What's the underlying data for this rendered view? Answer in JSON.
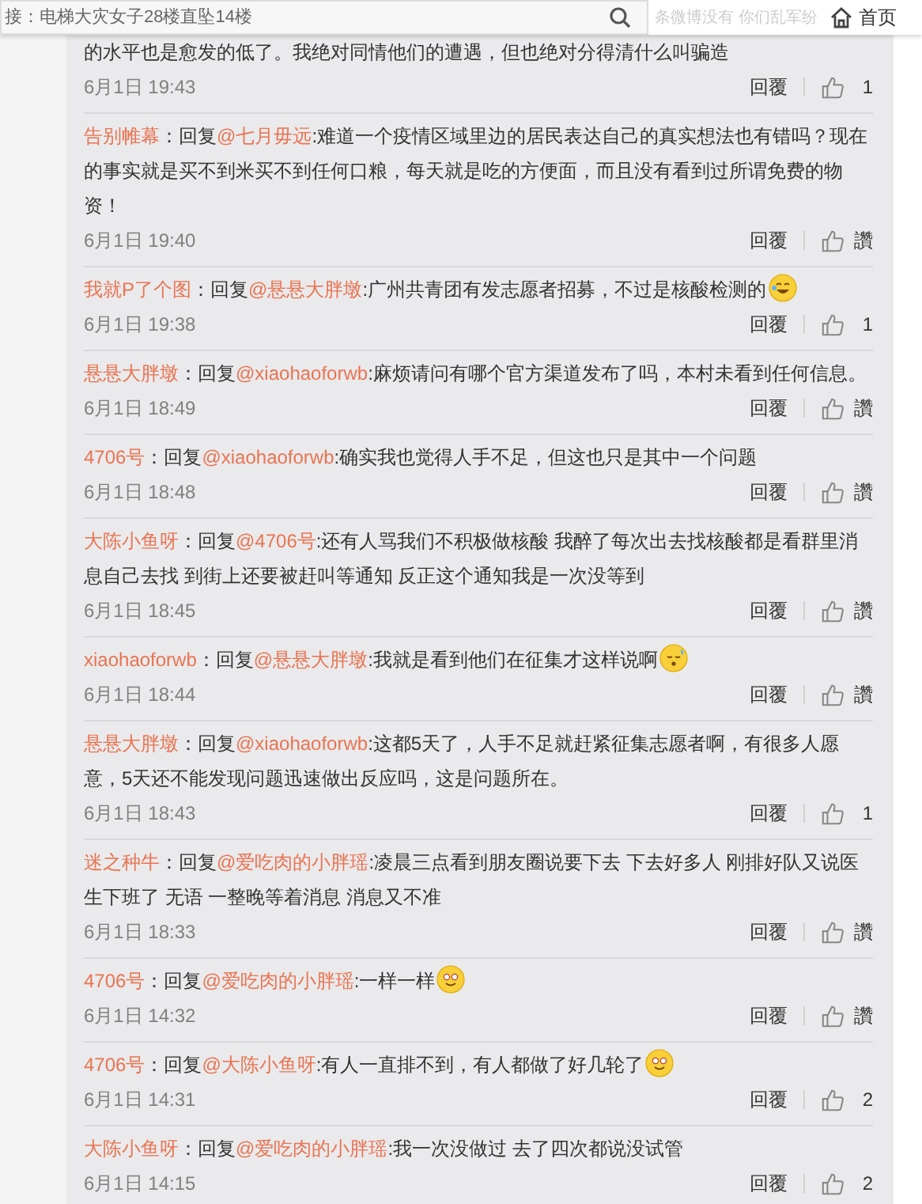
{
  "header": {
    "search": {
      "value": "接：电梯大灾女子28楼直坠14楼"
    },
    "marquee": "条微博没有 你们乱军纷",
    "home": "首页"
  },
  "comments": [
    {
      "text": "的水平也是愈发的低了。我绝对同情他们的遭遇，但也绝对分得清什么叫骗造",
      "time": "6月1日 19:43",
      "reply": "回覆",
      "likes": "1"
    },
    {
      "author": "告别帷幕",
      "prefix": "：回复",
      "reply_to": "@七月毋远",
      "text": ":难道一个疫情区域里边的居民表达自己的真实想法也有错吗？现在的事实就是买不到米买不到任何口粮，每天就是吃的方便面，而且没有看到过所谓免费的物资！",
      "time": "6月1日 19:40",
      "reply": "回覆",
      "likes": "讚"
    },
    {
      "author": "我就P了个图",
      "prefix": "：回复",
      "reply_to": "@悬悬大胖墩",
      "text": ":广州共青团有发志愿者招募，不过是核酸检测的",
      "kind": "laugh",
      "time": "6月1日 19:38",
      "reply": "回覆",
      "likes": "1"
    },
    {
      "author": "悬悬大胖墩",
      "prefix": "：回复",
      "reply_to": "@xiaohaoforwb",
      "text": ":麻烦请问有哪个官方渠道发布了吗，本村未看到任何信息。",
      "time": "6月1日 18:49",
      "reply": "回覆",
      "likes": "讚"
    },
    {
      "author": "4706号",
      "prefix": "：回复",
      "reply_to": "@xiaohaoforwb",
      "text": ":确实我也觉得人手不足，但这也只是其中一个问题",
      "time": "6月1日 18:48",
      "reply": "回覆",
      "likes": "讚"
    },
    {
      "author": "大陈小鱼呀",
      "prefix": "：回复",
      "reply_to": "@4706号",
      "text": ":还有人骂我们不积极做核酸 我醉了每次出去找核酸都是看群里消息自己去找 到街上还要被赶叫等通知 反正这个通知我是一次没等到",
      "time": "6月1日 18:45",
      "reply": "回覆",
      "likes": "讚"
    },
    {
      "author": "xiaohaoforwb",
      "prefix": "：回复",
      "reply_to": "@悬悬大胖墩",
      "text": ":我就是看到他们在征集才这样说啊",
      "kind": "sweat",
      "time": "6月1日 18:44",
      "reply": "回覆",
      "likes": "讚"
    },
    {
      "author": "悬悬大胖墩",
      "prefix": "：回复",
      "reply_to": "@xiaohaoforwb",
      "text": ":这都5天了，人手不足就赶紧征集志愿者啊，有很多人愿意，5天还不能发现问题迅速做出反应吗，这是问题所在。",
      "time": "6月1日 18:43",
      "reply": "回覆",
      "likes": "1"
    },
    {
      "author": "迷之种牛",
      "prefix": "：回复",
      "reply_to": "@爱吃肉的小胖瑶",
      "text": ":凌晨三点看到朋友圈说要下去 下去好多人 刚排好队又说医生下班了 无语 一整晚等着消息 消息又不准",
      "time": "6月1日 18:33",
      "reply": "回覆",
      "likes": "讚"
    },
    {
      "author": "4706号",
      "prefix": "：回复",
      "reply_to": "@爱吃肉的小胖瑶",
      "text": ":一样一样",
      "kind": "smile",
      "time": "6月1日 14:32",
      "reply": "回覆",
      "likes": "讚"
    },
    {
      "author": "4706号",
      "prefix": "：回复",
      "reply_to": "@大陈小鱼呀",
      "text": ":有人一直排不到，有人都做了好几轮了",
      "kind": "smile",
      "time": "6月1日 14:31",
      "reply": "回覆",
      "likes": "2"
    },
    {
      "author": "大陈小鱼呀",
      "prefix": "：回复",
      "reply_to": "@爱吃肉的小胖瑶",
      "text": ":我一次没做过 去了四次都说没试管",
      "time": "6月1日 14:15",
      "reply": "回覆",
      "likes": "2"
    }
  ]
}
